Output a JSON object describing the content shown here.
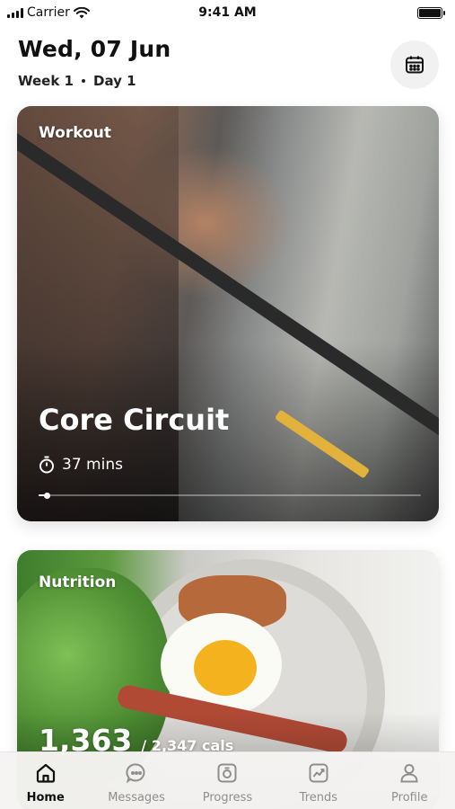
{
  "status_bar": {
    "carrier": "Carrier",
    "time": "9:41 AM"
  },
  "header": {
    "date": "Wed, 07 Jun",
    "week": "Week 1",
    "day": "Day 1",
    "calendar_icon": "calendar-icon"
  },
  "workout_card": {
    "label": "Workout",
    "title": "Core Circuit",
    "duration": "37 mins",
    "duration_icon": "stopwatch-icon",
    "progress": 0.02
  },
  "nutrition_card": {
    "label": "Nutrition",
    "calories": "1,363",
    "total": "/ 2,347 cals"
  },
  "tab_bar": {
    "items": [
      {
        "label": "Home",
        "icon": "home-icon",
        "active": true
      },
      {
        "label": "Messages",
        "icon": "messages-icon",
        "active": false
      },
      {
        "label": "Progress",
        "icon": "progress-icon",
        "active": false
      },
      {
        "label": "Trends",
        "icon": "trends-icon",
        "active": false
      },
      {
        "label": "Profile",
        "icon": "profile-icon",
        "active": false
      }
    ]
  },
  "colors": {
    "active_tab": "#111111",
    "inactive_tab": "#8e8e8e",
    "accent": "#ffffff"
  }
}
